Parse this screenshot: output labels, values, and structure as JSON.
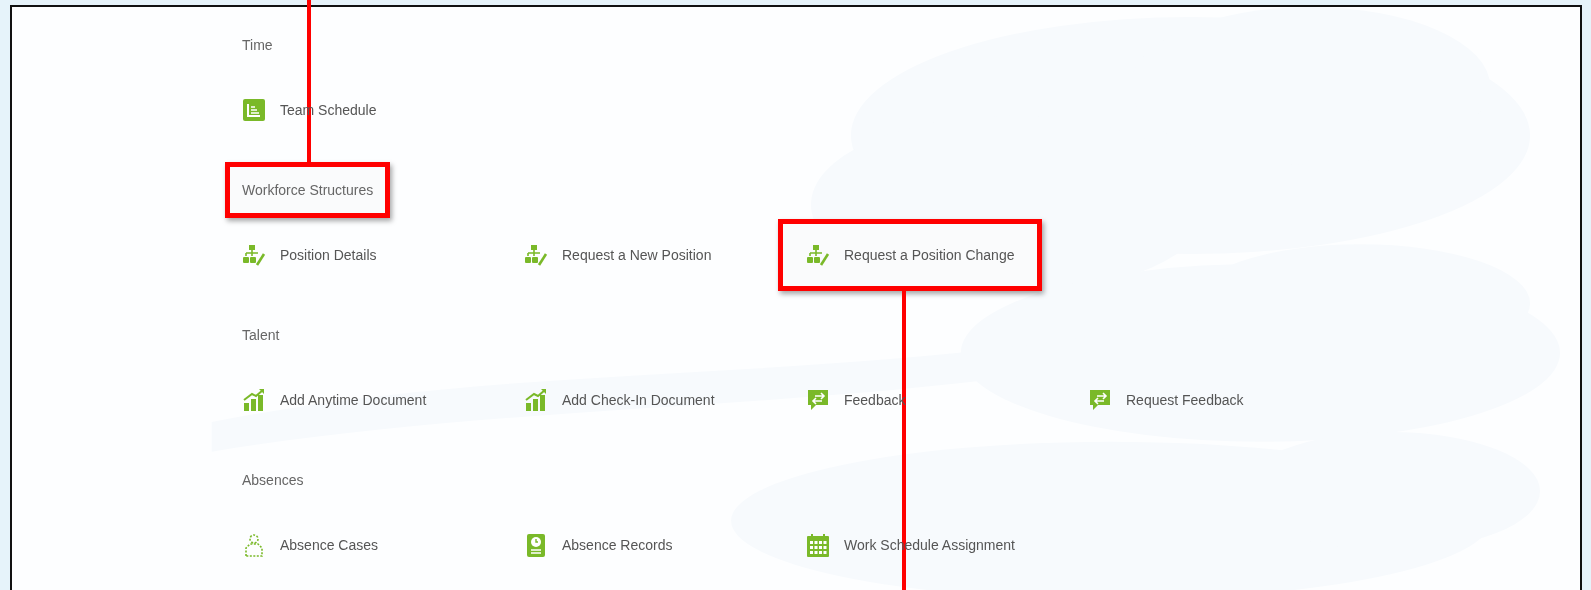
{
  "sections": [
    {
      "title": "Time",
      "highlighted": false,
      "items": [
        {
          "label": "Team Schedule",
          "kind": "schedule",
          "highlighted": false
        }
      ]
    },
    {
      "title": "Workforce Structures",
      "highlighted": true,
      "items": [
        {
          "label": "Position Details",
          "kind": "org-edit",
          "highlighted": false
        },
        {
          "label": "Request a New Position",
          "kind": "org-edit",
          "highlighted": false
        },
        {
          "label": "Request a Position Change",
          "kind": "org-edit",
          "highlighted": true
        }
      ]
    },
    {
      "title": "Talent",
      "highlighted": false,
      "items": [
        {
          "label": "Add Anytime Document",
          "kind": "growth",
          "highlighted": false
        },
        {
          "label": "Add Check-In Document",
          "kind": "growth",
          "highlighted": false
        },
        {
          "label": "Feedback",
          "kind": "chat",
          "highlighted": false
        },
        {
          "label": "Request Feedback",
          "kind": "chat",
          "highlighted": false
        }
      ]
    },
    {
      "title": "Absences",
      "highlighted": false,
      "items": [
        {
          "label": "Absence Cases",
          "kind": "person",
          "highlighted": false
        },
        {
          "label": "Absence Records",
          "kind": "badge",
          "highlighted": false
        },
        {
          "label": "Work Schedule Assignment",
          "kind": "calendar",
          "highlighted": false
        }
      ]
    }
  ]
}
